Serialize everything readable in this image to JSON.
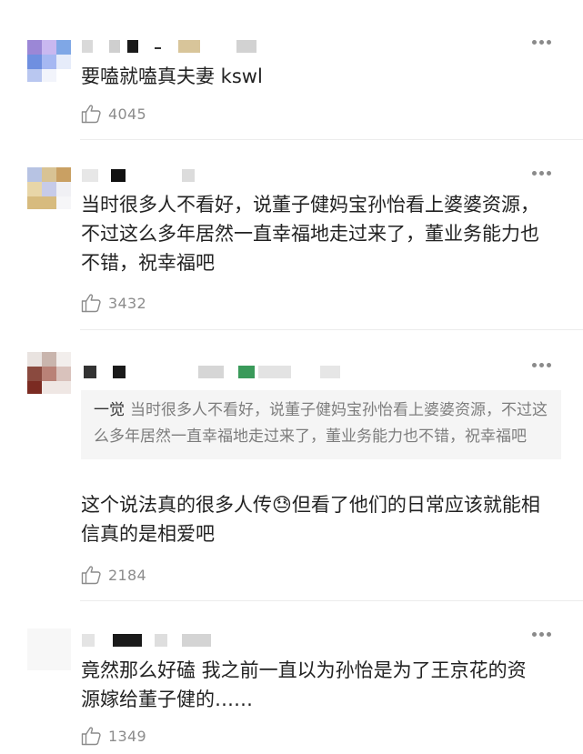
{
  "comments": [
    {
      "text": "要嗑就嗑真夫妻 kswl",
      "likes": "4045"
    },
    {
      "text": "当时很多人不看好，说董子健妈宝孙怡看上婆婆资源，不过这么多年居然一直幸福地走过来了，董业务能力也不错，祝幸福吧",
      "likes": "3432"
    },
    {
      "quote_name": "一觉",
      "quote_text": "当时很多人不看好，说董子健妈宝孙怡看上婆婆资源，不过这么多年居然一直幸福地走过来了，董业务能力也不错，祝幸福吧",
      "text": "这个说法真的很多人传😓但看了他们的日常应该就能相信真的是相爱吧",
      "likes": "2184"
    },
    {
      "text": "竟然那么好磕 我之前一直以为孙怡是为了王京花的资源嫁给董子健的……",
      "likes": "1349"
    }
  ],
  "icons": {
    "more": "more-dots-icon",
    "like": "thumbs-up-icon"
  },
  "colors": {
    "text": "#222222",
    "meta": "#8c8c8c",
    "quote_bg": "#f5f5f5",
    "divider": "#ececec"
  }
}
